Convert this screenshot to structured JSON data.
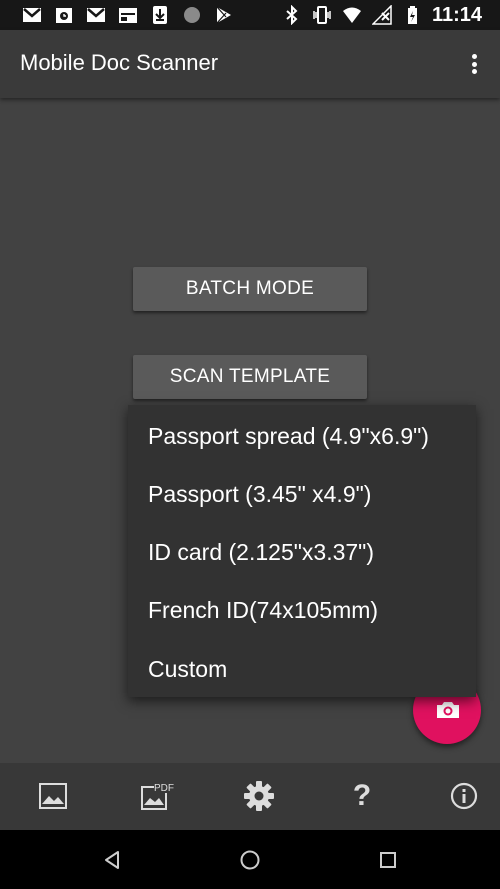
{
  "status_bar": {
    "time": "11:14",
    "left_icons": [
      "gmail-icon",
      "alarm-icon",
      "gmail-icon",
      "calendar-icon",
      "download-icon",
      "circle-icon",
      "play-store-icon"
    ],
    "right_icons": [
      "bluetooth-icon",
      "vibrate-icon",
      "wifi-icon",
      "no-signal-icon",
      "battery-icon"
    ]
  },
  "app_bar": {
    "title": "Mobile Doc Scanner",
    "overflow_icon": "more-vert-icon"
  },
  "main": {
    "batch_mode_label": "BATCH MODE",
    "scan_template_label": "SCAN TEMPLATE"
  },
  "template_menu": {
    "items": [
      "Passport spread (4.9\"x6.9\")",
      "Passport (3.45\" x4.9\")",
      "ID card (2.125\"x3.37\")",
      "French ID(74x105mm)",
      "Custom"
    ]
  },
  "fab": {
    "icon": "camera-icon",
    "color": "#e0115f"
  },
  "toolbar": {
    "items": [
      "image-icon",
      "pdf-icon",
      "gear-icon",
      "help-icon",
      "info-icon"
    ],
    "pdf_badge": "PDF"
  },
  "nav_bar": {
    "items": [
      "back-icon",
      "home-icon",
      "recents-icon"
    ]
  },
  "colors": {
    "background": "#424242",
    "app_bar": "#3a3a3a",
    "menu": "#323232",
    "accent": "#e0115f"
  }
}
